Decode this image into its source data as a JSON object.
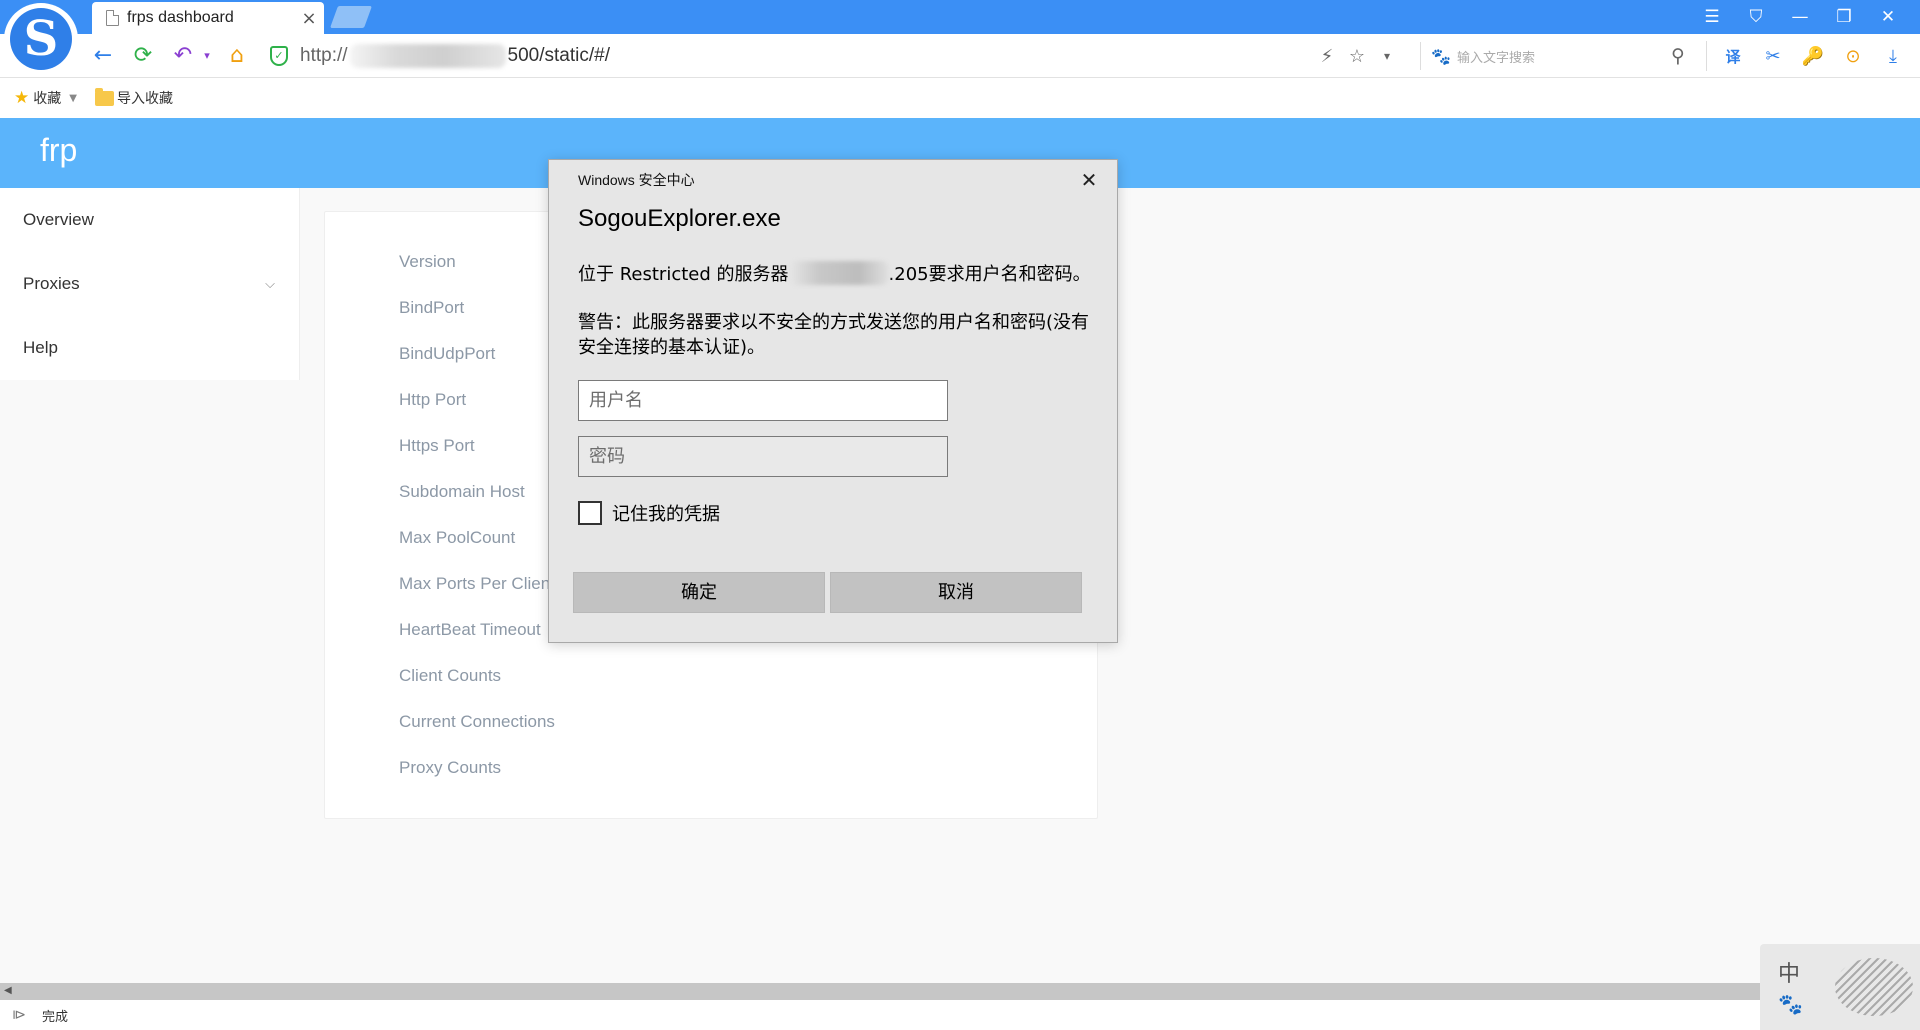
{
  "browser": {
    "tab": {
      "title": "frps dashboard",
      "close": "×"
    },
    "window_controls": [
      "☰",
      "⛉",
      "—",
      "❐",
      "✕"
    ],
    "nav": {
      "back": "←",
      "refresh": "⟳",
      "undo": "↶",
      "undo_caret": "▾",
      "home": "⌂"
    },
    "address": {
      "prefix": "http://",
      "suffix": "500/static/#/"
    },
    "address_icons": [
      "⚡",
      "☆",
      "▾"
    ],
    "search": {
      "placeholder": "输入文字搜索",
      "search_icon": "⚲"
    },
    "toolbar_icons": [
      "译",
      "✂",
      "🔑",
      "⊙",
      "⤓"
    ],
    "bookmarks": {
      "favorites": "收藏",
      "import": "导入收藏"
    },
    "status": {
      "text": "完成"
    },
    "colors": {
      "titlebar": "#3b8ff5",
      "accent": "#5bb4fb"
    }
  },
  "app": {
    "brand": "frp",
    "sidebar": [
      {
        "label": "Overview"
      },
      {
        "label": "Proxies",
        "chevron": "⌵"
      },
      {
        "label": "Help"
      }
    ],
    "info_labels": [
      "Version",
      "BindPort",
      "BindUdpPort",
      "Http Port",
      "Https Port",
      "Subdomain Host",
      "Max PoolCount",
      "Max Ports Per Client",
      "HeartBeat Timeout",
      "Client Counts",
      "Current Connections",
      "Proxy Counts"
    ]
  },
  "dialog": {
    "caption": "Windows 安全中心",
    "close": "✕",
    "title": "SogouExplorer.exe",
    "message_prefix": "位于 Restricted 的服务器",
    "message_suffix": ".205要求用户名和密码。",
    "warning": "警告：此服务器要求以不安全的方式发送您的用户名和密码(没有安全连接的基本认证)。",
    "username_placeholder": "用户名",
    "password_placeholder": "密码",
    "remember": "记住我的凭据",
    "ok": "确定",
    "cancel": "取消"
  },
  "ime": {
    "mode": "中"
  }
}
